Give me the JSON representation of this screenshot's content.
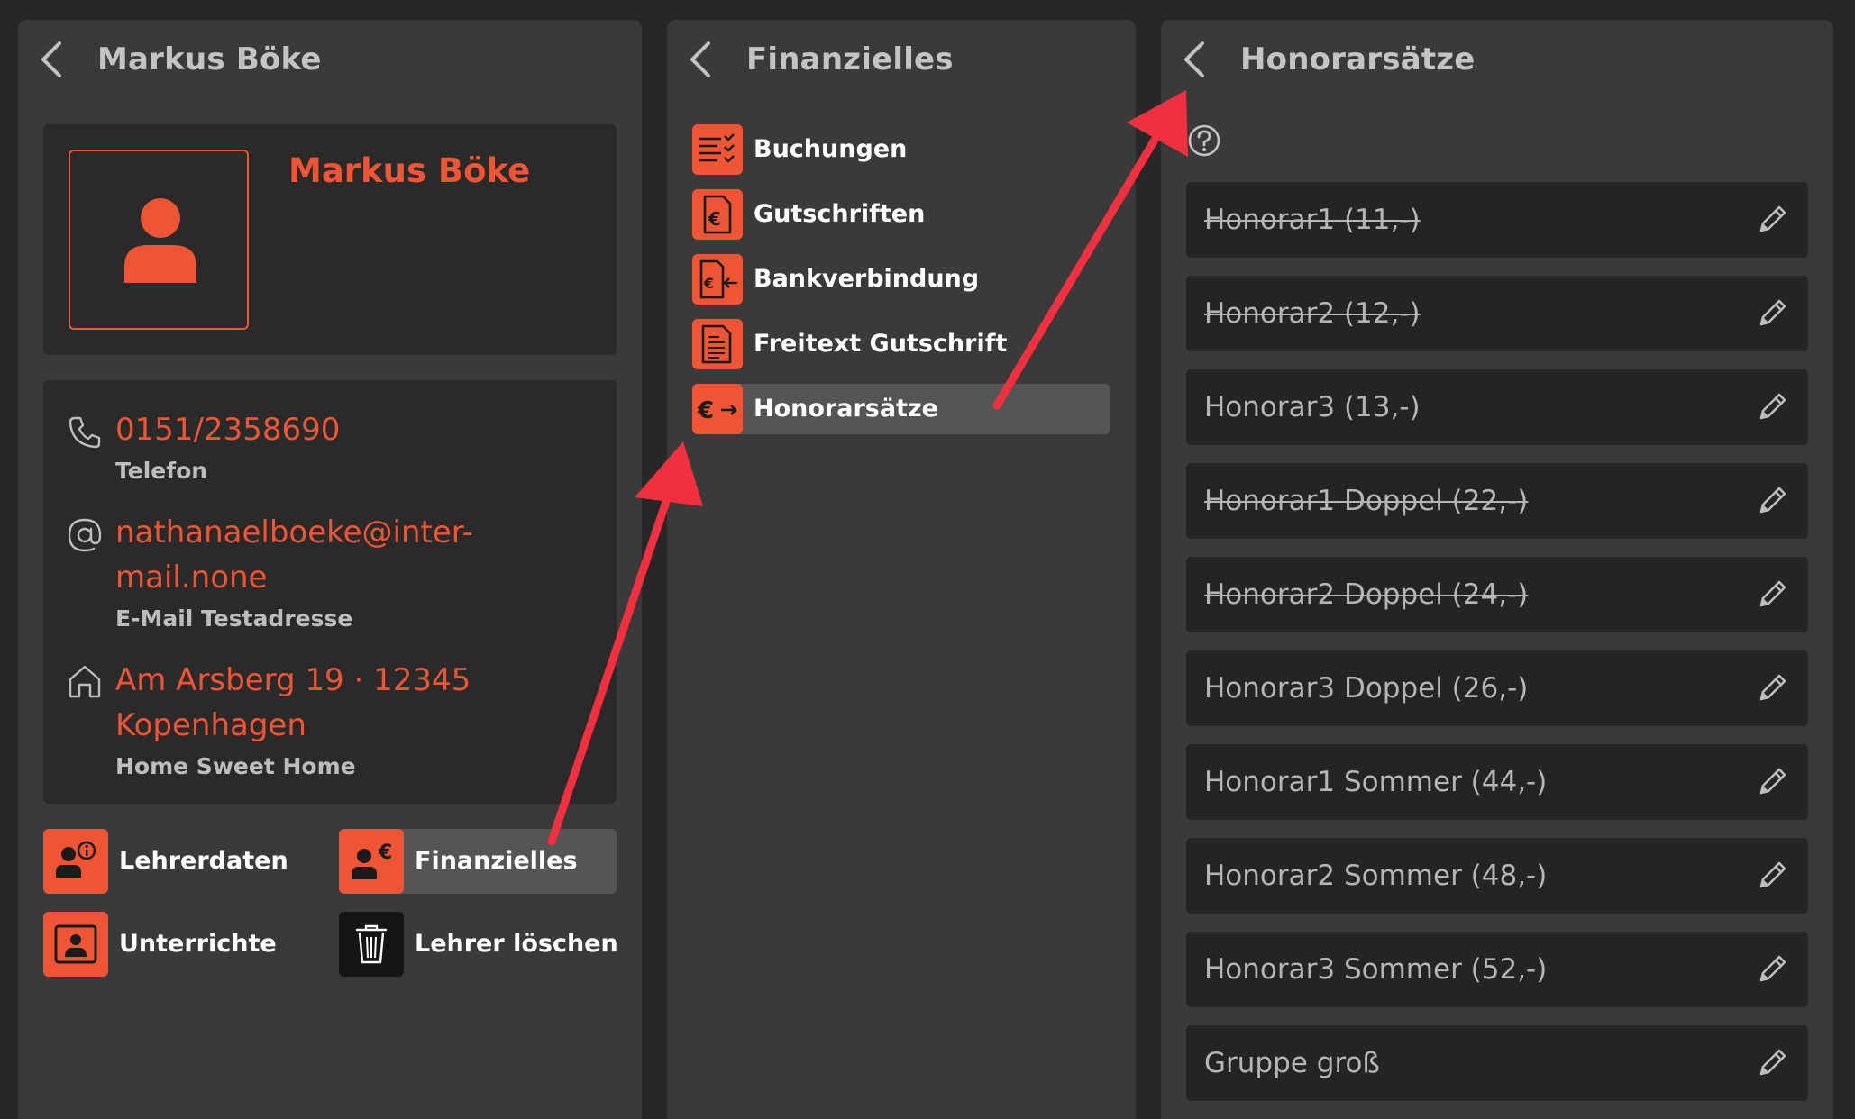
{
  "left_panel": {
    "title": "Markus Böke",
    "profile": {
      "name": "Markus Böke"
    },
    "contact": {
      "phone": {
        "value": "0151/2358690",
        "label": "Telefon"
      },
      "email": {
        "value_line1": "nathanaelboeke@inter-",
        "value_line2": "mail.none",
        "label": "E-Mail Testadresse"
      },
      "address": {
        "value_line1": "Am Arsberg 19 · 12345",
        "value_line2": "Kopenhagen",
        "label": "Home Sweet Home"
      }
    },
    "actions": [
      {
        "label": "Lehrerdaten",
        "icon": "teacher-info-icon"
      },
      {
        "label": "Finanzielles",
        "icon": "teacher-euro-icon",
        "selected": true
      },
      {
        "label": "Unterrichte",
        "icon": "lessons-icon"
      },
      {
        "label": "Lehrer löschen",
        "icon": "trash-icon"
      }
    ]
  },
  "middle_panel": {
    "title": "Finanzielles",
    "menu": [
      {
        "label": "Buchungen",
        "icon": "bookings-icon"
      },
      {
        "label": "Gutschriften",
        "icon": "credit-note-icon"
      },
      {
        "label": "Bankverbindung",
        "icon": "bank-connection-icon"
      },
      {
        "label": "Freitext Gutschrift",
        "icon": "freetext-credit-icon"
      },
      {
        "label": "Honorarsätze",
        "icon": "fee-rates-icon",
        "selected": true
      }
    ]
  },
  "right_panel": {
    "title": "Honorarsätze",
    "rates": [
      {
        "label": "Honorar1 (11,-)",
        "struck": true
      },
      {
        "label": "Honorar2 (12,-)",
        "struck": true
      },
      {
        "label": "Honorar3 (13,-)",
        "struck": false
      },
      {
        "label": "Honorar1 Doppel (22,-)",
        "struck": true
      },
      {
        "label": "Honorar2 Doppel (24,-)",
        "struck": true
      },
      {
        "label": "Honorar3 Doppel (26,-)",
        "struck": false
      },
      {
        "label": "Honorar1 Sommer (44,-)",
        "struck": false
      },
      {
        "label": "Honorar2 Sommer (48,-)",
        "struck": false
      },
      {
        "label": "Honorar3 Sommer (52,-)",
        "struck": false
      },
      {
        "label": "Gruppe groß",
        "struck": false
      }
    ]
  },
  "colors": {
    "accent": "#ed5535",
    "annotation_arrow": "#f0303f",
    "panel_bg": "#3a3a3a",
    "card_bg": "#2a2a2a"
  }
}
